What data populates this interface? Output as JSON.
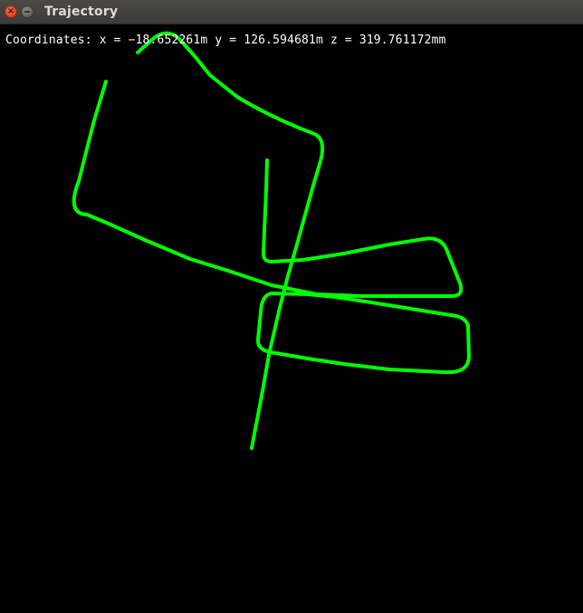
{
  "window": {
    "title": "Trajectory",
    "close_glyph": "×"
  },
  "overlay": {
    "coordinates_text": "Coordinates: x = −18.652261m y = 126.594681m z = 319.761172mm"
  },
  "colors": {
    "background": "#000000",
    "trajectory": "#00ff00",
    "text": "#ffffff"
  },
  "icons": {
    "close": "close-icon",
    "minimize": "minimize-icon"
  }
}
